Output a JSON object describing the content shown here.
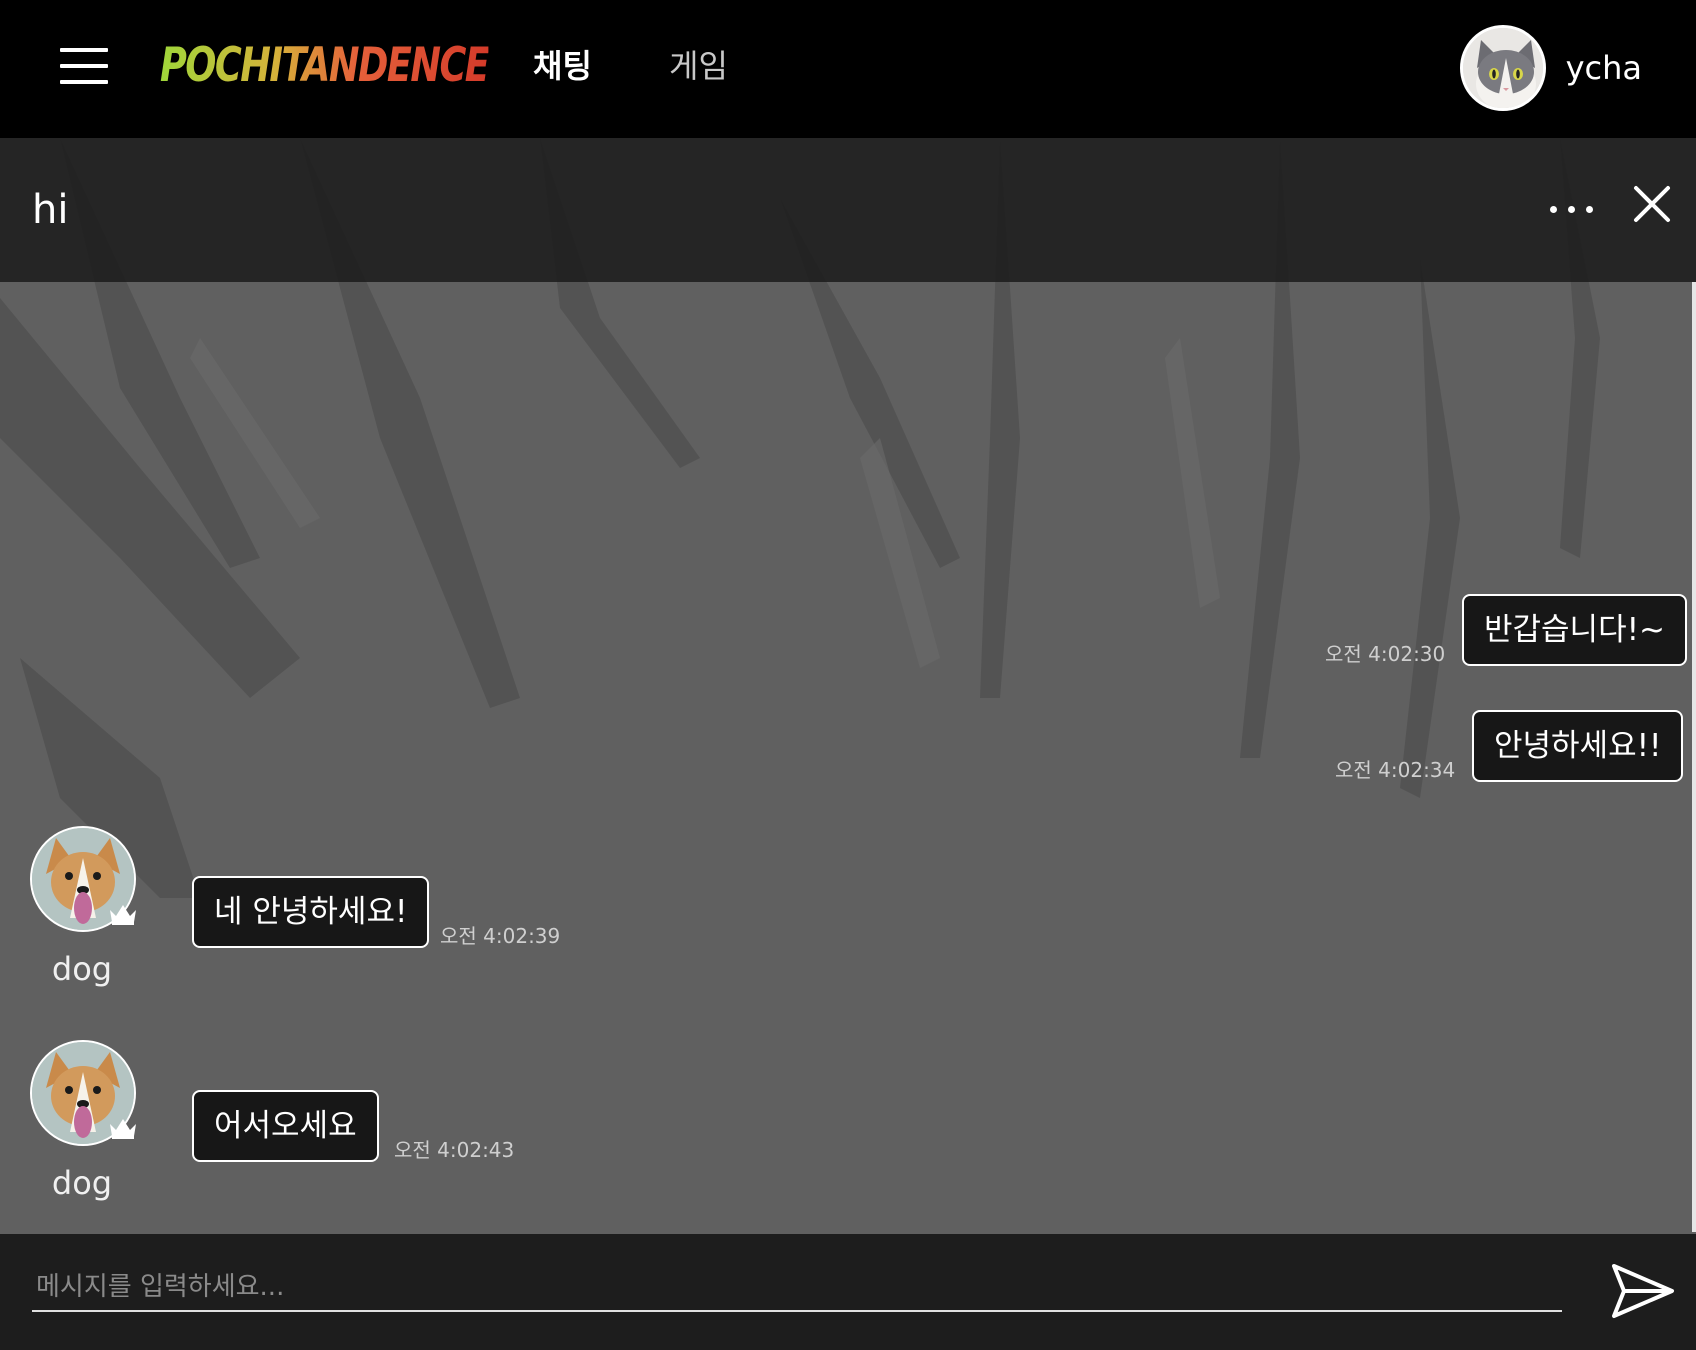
{
  "nav": {
    "logo": "POCHITANDENCE",
    "items": [
      {
        "label": "채팅",
        "active": true
      },
      {
        "label": "게임",
        "active": false
      }
    ],
    "user": {
      "name": "ycha"
    }
  },
  "room": {
    "title": "hi"
  },
  "messages": [
    {
      "mine": true,
      "text": "반갑습니다!~",
      "time": "오전 4:02:30"
    },
    {
      "mine": true,
      "text": "안녕하세요!!",
      "time": "오전 4:02:34"
    },
    {
      "mine": false,
      "sender": "dog",
      "text": "네 안녕하세요!",
      "time": "오전 4:02:39"
    },
    {
      "mine": false,
      "sender": "dog",
      "text": "어서오세요",
      "time": "오전 4:02:43"
    }
  ],
  "composer": {
    "placeholder": "메시지를 입력하세요..."
  },
  "colors": {
    "header": "#000000",
    "chat_header": "#1c1c1c",
    "bubble_bg": "#171717",
    "bubble_border": "#ffffff",
    "input_bar": "#1d1d1d"
  }
}
